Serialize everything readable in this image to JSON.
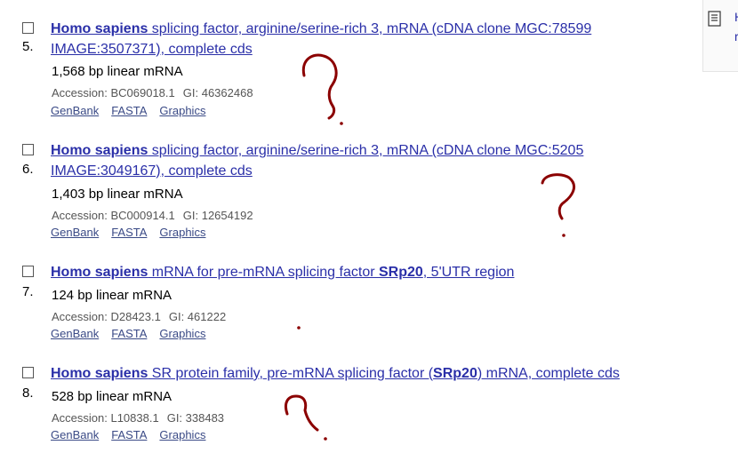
{
  "sidebar": {
    "icon": "document-icon",
    "text_line1": "H",
    "text_line2": "r"
  },
  "results": [
    {
      "number": "5.",
      "title_organism": "Homo sapiens",
      "title_rest": " splicing factor, arginine/serine-rich 3, mRNA (cDNA clone MGC:78599",
      "title_line2": "IMAGE:3507371), complete cds",
      "desc": "1,568 bp linear mRNA",
      "accession": "Accession: BC069018.1",
      "gi": "GI: 46362468",
      "links": [
        "GenBank",
        "FASTA",
        "Graphics"
      ]
    },
    {
      "number": "6.",
      "title_organism": "Homo sapiens",
      "title_rest": " splicing factor, arginine/serine-rich 3, mRNA (cDNA clone MGC:5205",
      "title_line2": "IMAGE:3049167), complete cds",
      "desc": "1,403 bp linear mRNA",
      "accession": "Accession: BC000914.1",
      "gi": "GI: 12654192",
      "links": [
        "GenBank",
        "FASTA",
        "Graphics"
      ]
    },
    {
      "number": "7.",
      "title_organism": "Homo sapiens",
      "title_rest_a": " mRNA for pre-mRNA splicing factor ",
      "title_bold": "SRp20",
      "title_rest_b": ", 5'UTR region",
      "desc": "124 bp linear mRNA",
      "accession": "Accession: D28423.1",
      "gi": "GI: 461222",
      "links": [
        "GenBank",
        "FASTA",
        "Graphics"
      ]
    },
    {
      "number": "8.",
      "title_organism": "Homo sapiens",
      "title_rest_a": " SR protein family, pre-mRNA splicing factor (",
      "title_bold": "SRp20",
      "title_rest_b": ") mRNA, complete cds",
      "desc": "528 bp linear mRNA",
      "accession": "Accession: L10838.1",
      "gi": "GI: 338483",
      "links": [
        "GenBank",
        "FASTA",
        "Graphics"
      ]
    }
  ],
  "annotation_color": "#8b0000"
}
